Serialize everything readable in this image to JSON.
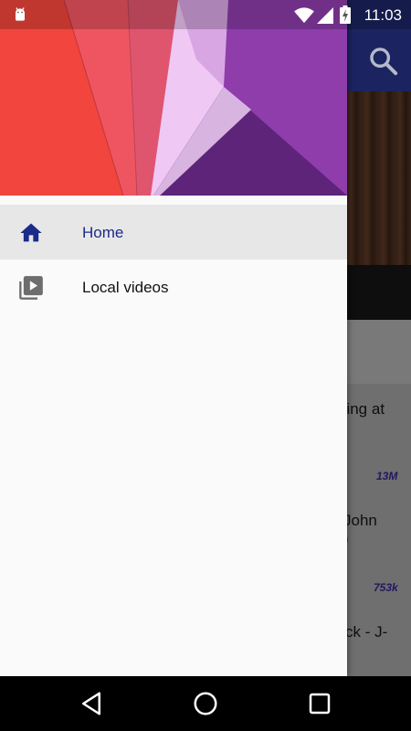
{
  "status_bar": {
    "time": "11:03",
    "icons": [
      "android-debug-icon",
      "wifi-icon",
      "signal-icon",
      "battery-charging-icon"
    ]
  },
  "drawer": {
    "header_art": "material-geometric-header",
    "items": [
      {
        "label": "Home",
        "icon": "home-icon",
        "selected": true
      },
      {
        "label": "Local videos",
        "icon": "video-library-icon",
        "selected": false
      }
    ],
    "accent_color": "#1c2a8a"
  },
  "background_app": {
    "list_snippets": [
      "ning at",
      "13M",
      "John",
      ")",
      "753k",
      "ck - J-"
    ]
  },
  "nav_bar": {
    "buttons": [
      "back-button",
      "home-button",
      "recents-button"
    ]
  }
}
